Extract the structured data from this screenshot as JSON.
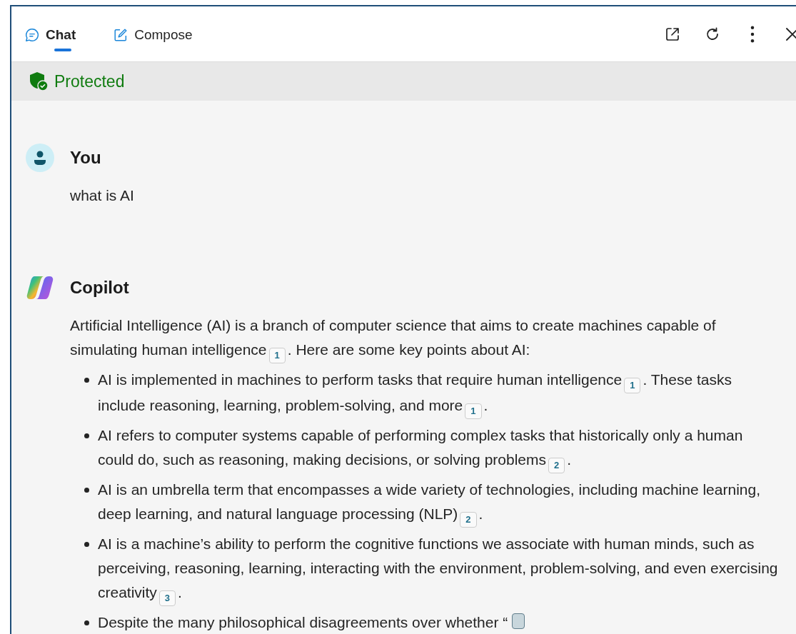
{
  "tabs": [
    {
      "label": "Chat",
      "kind": "chat",
      "selected": true
    },
    {
      "label": "Compose",
      "kind": "compose",
      "selected": false
    }
  ],
  "banner": {
    "label": "Protected"
  },
  "messages": [
    {
      "author": "You",
      "kind": "user",
      "paragraphs": [
        [
          {
            "kind": "text",
            "text": "what is AI"
          }
        ]
      ]
    },
    {
      "author": "Copilot",
      "kind": "bot",
      "paragraphs": [
        [
          {
            "kind": "text",
            "text": "Artificial Intelligence (AI) is a branch of computer science that aims to create machines capable of simulating human intelligence"
          },
          {
            "kind": "cite",
            "text": "1"
          },
          {
            "kind": "text",
            "text": ". Here are some key points about AI:"
          }
        ]
      ],
      "bullets": [
        [
          {
            "kind": "text",
            "text": "AI is implemented in machines to perform tasks that require human intelligence"
          },
          {
            "kind": "cite",
            "text": "1"
          },
          {
            "kind": "text",
            "text": ". These tasks include reasoning, learning, problem-solving, and more"
          },
          {
            "kind": "cite",
            "text": "1"
          },
          {
            "kind": "text",
            "text": "."
          }
        ],
        [
          {
            "kind": "text",
            "text": "AI refers to computer systems capable of performing complex tasks that historically only a human could do, such as reasoning, making decisions, or solving problems"
          },
          {
            "kind": "cite",
            "text": "2"
          },
          {
            "kind": "text",
            "text": "."
          }
        ],
        [
          {
            "kind": "text",
            "text": "AI is an umbrella term that encompasses a wide variety of technologies, including machine learning, deep learning, and natural language processing (NLP)"
          },
          {
            "kind": "cite",
            "text": "2"
          },
          {
            "kind": "text",
            "text": "."
          }
        ],
        [
          {
            "kind": "text",
            "text": "AI is a machine’s ability to perform the cognitive functions we associate with human minds, such as perceiving, reasoning, learning, interacting with the environment, problem-solving, and even exercising creativity"
          },
          {
            "kind": "cite",
            "text": "3"
          },
          {
            "kind": "text",
            "text": "."
          }
        ],
        [
          {
            "kind": "text",
            "text": "Despite the many philosophical disagreements over whether “"
          },
          {
            "kind": "chip"
          }
        ]
      ]
    }
  ]
}
